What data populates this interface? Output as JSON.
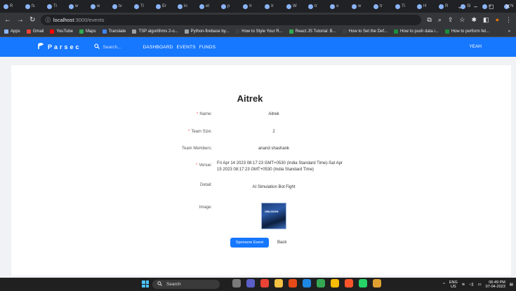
{
  "browser": {
    "tabs": [
      {
        "label": "R",
        "active": false
      },
      {
        "label": "fs",
        "active": false
      },
      {
        "label": "Ti",
        "active": false
      },
      {
        "label": "w",
        "active": false
      },
      {
        "label": "w",
        "active": false
      },
      {
        "label": "tv",
        "active": false
      },
      {
        "label": "Ti",
        "active": false
      },
      {
        "label": "Er",
        "active": false
      },
      {
        "label": "in",
        "active": false
      },
      {
        "label": "et",
        "active": false
      },
      {
        "label": "p",
        "active": false
      },
      {
        "label": "Ir",
        "active": false
      },
      {
        "label": "Ir",
        "active": false
      },
      {
        "label": "W",
        "active": false
      },
      {
        "label": "tr",
        "active": false
      },
      {
        "label": "o",
        "active": false
      },
      {
        "label": "w",
        "active": false
      },
      {
        "label": "tr",
        "active": false
      },
      {
        "label": "Ti",
        "active": false
      },
      {
        "label": "H",
        "active": false
      },
      {
        "label": "R",
        "active": false
      },
      {
        "label": "Sl",
        "active": false
      },
      {
        "label": "o",
        "active": false
      },
      {
        "label": "N",
        "active": false
      },
      {
        "label": "×",
        "active": true
      },
      {
        "label": "N",
        "active": false
      }
    ],
    "new_tab": "+",
    "window_controls": {
      "chevron": "⌄",
      "minimize": "–",
      "restore": "◻",
      "close": "✕"
    },
    "address": {
      "host": "localhost",
      "path": ":3000/events"
    },
    "bookmarks": [
      {
        "label": "Apps",
        "color": "#8ab4f8"
      },
      {
        "label": "Gmail",
        "color": "#ea4335"
      },
      {
        "label": "YouTube",
        "color": "#ff0000"
      },
      {
        "label": "Maps",
        "color": "#34a853"
      },
      {
        "label": "Translate",
        "color": "#4285f4"
      },
      {
        "label": "TSP algorithms 2-o...",
        "color": "#9aa0a6"
      },
      {
        "label": "Python-firebase by...",
        "color": "#9aa0a6"
      },
      {
        "label": "How to Style Your R...",
        "color": "#3c4043"
      },
      {
        "label": "React JS Tutorial: B...",
        "color": "#34a853"
      },
      {
        "label": "How to Set the Def...",
        "color": "#3c4043"
      },
      {
        "label": "How to push data i...",
        "color": "#1e8e3e"
      },
      {
        "label": "How to perform fet...",
        "color": "#1e8e3e"
      }
    ],
    "bookmarks_more": "»"
  },
  "app": {
    "brand": "Parsec",
    "search_placeholder": "Search...",
    "menu": [
      "DASHBOARD",
      "EVENTS",
      "FUNDS"
    ],
    "user": "YEAH"
  },
  "event": {
    "title": "Aitrek",
    "fields": {
      "name_label": "Name:",
      "name_value": "Aitrek",
      "team_size_label": "Team Size:",
      "team_size_value": "2",
      "members_label": "Team Members:",
      "members_value": "anand shashank",
      "venue_label": "Venue:",
      "venue_value": "Fri Apr 14 2023 08:17:23 GMT+0530 (India Standard Time)-Sat Apr 15 2023 08:17:23 GMT+0530 (India Standard Time)",
      "detail_label": "Detail:",
      "detail_value": "AI Simulation Bot Fight",
      "image_label": "Image:",
      "image_text": "OBLIVION"
    },
    "required_mark": "*",
    "sponsor_button": "Sponsore Event",
    "back_button": "Back"
  },
  "taskbar": {
    "search": "Search",
    "lang_top": "ENG",
    "lang_bottom": "US",
    "time": "06:49 PM",
    "date": "07-04-2023"
  },
  "colors": {
    "primary": "#1677ff",
    "required": "#ff4d4f"
  }
}
